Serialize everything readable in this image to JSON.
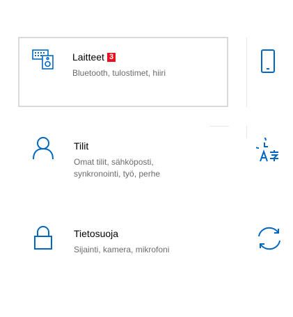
{
  "tiles": {
    "devices": {
      "title": "Laitteet",
      "badge": "3",
      "description": "Bluetooth, tulostimet, hiiri",
      "icon": "keyboard-speaker-icon"
    },
    "accounts": {
      "title": "Tilit",
      "description": "Omat tilit, sähköposti, synkronointi, työ, perhe",
      "icon": "person-icon"
    },
    "privacy": {
      "title": "Tietosuoja",
      "description": "Sijainti, kamera, mikrofoni",
      "icon": "lock-icon"
    },
    "phone": {
      "icon": "phone-icon"
    },
    "time_language": {
      "icon": "time-language-icon"
    },
    "update": {
      "icon": "sync-icon"
    }
  },
  "colors": {
    "accent": "#0067c0",
    "badge": "#e81123",
    "hover_border": "#d9d9d9"
  }
}
